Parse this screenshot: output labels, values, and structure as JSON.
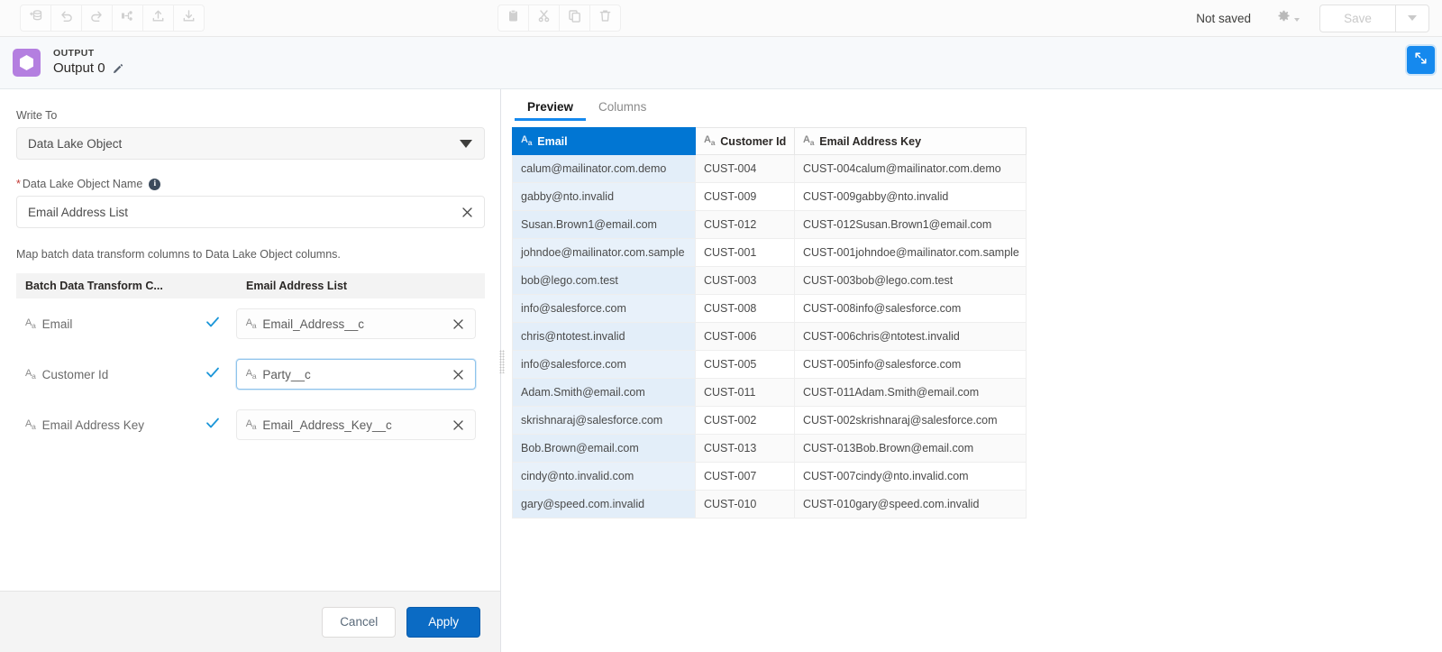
{
  "toolbar": {
    "left_icons": [
      {
        "name": "add-object-icon",
        "title": "Add"
      },
      {
        "name": "undo-icon",
        "title": "Undo"
      },
      {
        "name": "redo-icon",
        "title": "Redo"
      },
      {
        "name": "branch-icon",
        "title": "Branch"
      },
      {
        "name": "upload-icon",
        "title": "Upload"
      },
      {
        "name": "download-icon",
        "title": "Download"
      }
    ],
    "mid_icons": [
      {
        "name": "paste-icon",
        "title": "Paste"
      },
      {
        "name": "cut-icon",
        "title": "Cut"
      },
      {
        "name": "copy-icon",
        "title": "Copy"
      },
      {
        "name": "delete-icon",
        "title": "Delete"
      }
    ],
    "status_text": "Not saved",
    "gear_label": "gear-icon",
    "save_label": "Save",
    "save_menu_label": "save-dropdown-caret"
  },
  "node_header": {
    "kicker": "OUTPUT",
    "title": "Output 0",
    "edit_icon": "pencil-icon",
    "expand_icon": "expand-icon",
    "accent_color": "#b47fe0"
  },
  "left_panel": {
    "write_to_label": "Write To",
    "write_to_value": "Data Lake Object",
    "object_name_label": "Data Lake Object Name",
    "object_name_required": "*",
    "object_name_value": "Email Address List",
    "map_note": "Map batch data transform columns to Data Lake Object columns.",
    "map_headers": {
      "source": "Batch Data Transform C...",
      "target": "Email Address List"
    },
    "mappings": [
      {
        "source": "Email",
        "target": "Email_Address__c",
        "mapped": true,
        "focused": false
      },
      {
        "source": "Customer Id",
        "target": "Party__c",
        "mapped": true,
        "focused": true
      },
      {
        "source": "Email Address Key",
        "target": "Email_Address_Key__c",
        "mapped": true,
        "focused": false
      }
    ],
    "cancel_label": "Cancel",
    "apply_label": "Apply",
    "apply_color": "#0b6bc4"
  },
  "right_panel": {
    "tabs": [
      {
        "label": "Preview",
        "active": true
      },
      {
        "label": "Columns",
        "active": false
      }
    ],
    "table": {
      "selected_column": "Email",
      "columns": [
        "Email",
        "Customer Id",
        "Email Address Key"
      ],
      "rows": [
        [
          "calum@mailinator.com.demo",
          "CUST-004",
          "CUST-004calum@mailinator.com.demo"
        ],
        [
          "gabby@nto.invalid",
          "CUST-009",
          "CUST-009gabby@nto.invalid"
        ],
        [
          "Susan.Brown1@email.com",
          "CUST-012",
          "CUST-012Susan.Brown1@email.com"
        ],
        [
          "johndoe@mailinator.com.sample",
          "CUST-001",
          "CUST-001johndoe@mailinator.com.sample"
        ],
        [
          "bob@lego.com.test",
          "CUST-003",
          "CUST-003bob@lego.com.test"
        ],
        [
          "info@salesforce.com",
          "CUST-008",
          "CUST-008info@salesforce.com"
        ],
        [
          "chris@ntotest.invalid",
          "CUST-006",
          "CUST-006chris@ntotest.invalid"
        ],
        [
          "info@salesforce.com",
          "CUST-005",
          "CUST-005info@salesforce.com"
        ],
        [
          "Adam.Smith@email.com",
          "CUST-011",
          "CUST-011Adam.Smith@email.com"
        ],
        [
          "skrishnaraj@salesforce.com",
          "CUST-002",
          "CUST-002skrishnaraj@salesforce.com"
        ],
        [
          "Bob.Brown@email.com",
          "CUST-013",
          "CUST-013Bob.Brown@email.com"
        ],
        [
          "cindy@nto.invalid.com",
          "CUST-007",
          "CUST-007cindy@nto.invalid.com"
        ],
        [
          "gary@speed.com.invalid",
          "CUST-010",
          "CUST-010gary@speed.com.invalid"
        ]
      ]
    }
  }
}
